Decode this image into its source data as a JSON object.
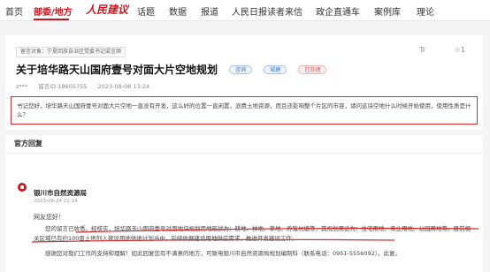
{
  "nav": {
    "items": [
      "首页",
      "部委/地方",
      "话题",
      "数据",
      "报道",
      "人民日报读者来信",
      "政企直通车",
      "案例库",
      "理论"
    ],
    "logo": "人民建议"
  },
  "message": {
    "recipient_label": "留言对象：宁夏回族自治区党委书记梁言顺",
    "title": "关于培华路天山国府壹号对面大片空地规划",
    "tags": [
      "咨询",
      "城建",
      "已办理"
    ],
    "author": "z***",
    "id": "留言ID:18605755",
    "date": "2023-08-08 13:24",
    "font_size_icon": "Tr",
    "likes": "☆1",
    "body": "书记您好，培华路天山国府壹号对面大片空地一直没有开发，这么好的位置一直闲置，浪费土地资源，而且还影响整个片区的市容，请问这块空地什么时候开始使用，使用性质是什么？"
  },
  "reply": {
    "heading": "官方回复",
    "org": "银川市自然资源局",
    "date": "2023-08-24 22:24",
    "greeting": "网友您好！",
    "text": "您的留言已收悉。经核实，培华路天山国府壹号对面地块规划用地现状为：耕地、林地、草地、养殖坑塘等，其规划用途为：住宅用地、商业用地、公园用地等。目前相关区域已有约100亩土地列入建设用地供地计划当中，后续依据建设用地供应需求，推进开发建设工作。",
    "tail": "感谢您对我们工作的支持和理解！如此回复您有不满意的地方，可致电银川市自然资源局规划编制科（联系电话：0951-5556092）。此复。"
  },
  "colors": {
    "accent": "#c8171e",
    "highlight_box": "#d42a2a"
  }
}
